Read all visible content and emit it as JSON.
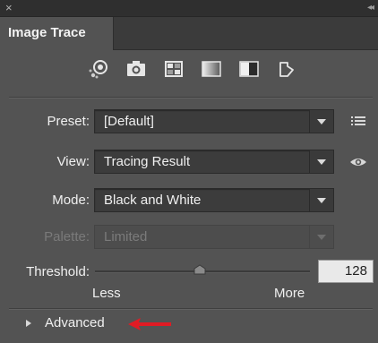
{
  "panel": {
    "close_glyph": "×",
    "collapse_glyph": "◂◂",
    "tab_title": "Image Trace"
  },
  "presets_icons": [
    {
      "name": "auto-color-icon"
    },
    {
      "name": "high-color-icon"
    },
    {
      "name": "low-color-icon"
    },
    {
      "name": "grayscale-icon"
    },
    {
      "name": "black-and-white-icon"
    },
    {
      "name": "outline-icon"
    }
  ],
  "fields": {
    "preset": {
      "label": "Preset:",
      "value": "[Default]"
    },
    "view": {
      "label": "View:",
      "value": "Tracing Result"
    },
    "mode": {
      "label": "Mode:",
      "value": "Black and White"
    },
    "palette": {
      "label": "Palette:",
      "value": "Limited"
    }
  },
  "threshold": {
    "label": "Threshold:",
    "value": "128",
    "min_label": "Less",
    "max_label": "More",
    "level": 0.5
  },
  "advanced": {
    "label": "Advanced"
  },
  "colors": {
    "panel_bg": "#535353",
    "annotation_arrow": "#e01b24"
  }
}
